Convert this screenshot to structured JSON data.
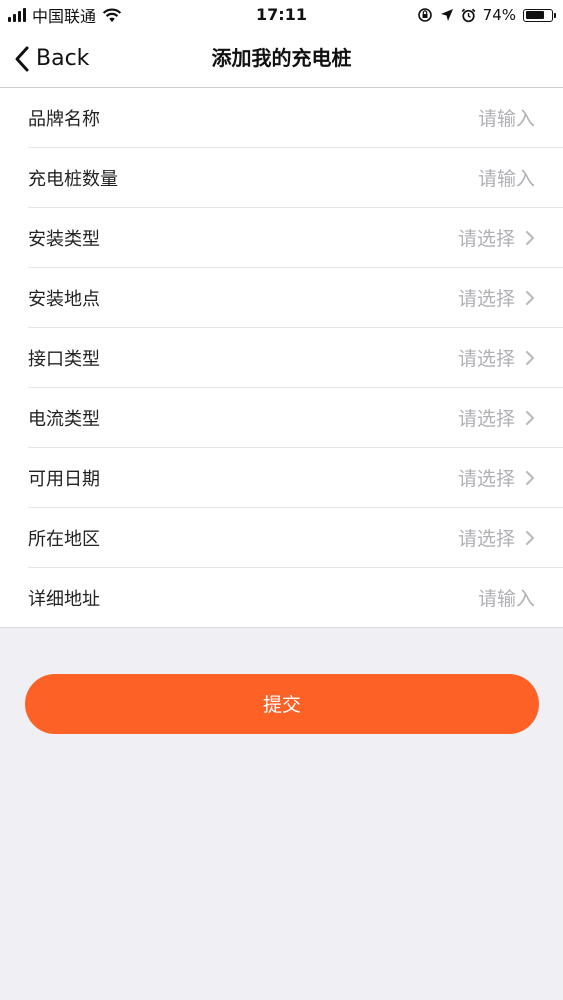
{
  "status_bar": {
    "carrier": "中国联通",
    "time": "17:11",
    "battery_percent": "74%",
    "battery_level": 0.74
  },
  "nav": {
    "back_label": "Back",
    "title": "添加我的充电桩"
  },
  "form": {
    "rows": [
      {
        "label": "品牌名称",
        "placeholder": "请输入",
        "type": "input"
      },
      {
        "label": "充电桩数量",
        "placeholder": "请输入",
        "type": "input"
      },
      {
        "label": "安装类型",
        "placeholder": "请选择",
        "type": "select"
      },
      {
        "label": "安装地点",
        "placeholder": "请选择",
        "type": "select"
      },
      {
        "label": "接口类型",
        "placeholder": "请选择",
        "type": "select"
      },
      {
        "label": "电流类型",
        "placeholder": "请选择",
        "type": "select"
      },
      {
        "label": "可用日期",
        "placeholder": "请选择",
        "type": "select"
      },
      {
        "label": "所在地区",
        "placeholder": "请选择",
        "type": "select"
      },
      {
        "label": "详细地址",
        "placeholder": "请输入",
        "type": "input"
      }
    ]
  },
  "submit": {
    "label": "提交",
    "color": "#fd6125"
  },
  "icons": {
    "back": "chevron-left-icon",
    "row_arrow": "chevron-right-icon",
    "wifi": "wifi-icon",
    "location": "location-arrow-icon",
    "alarm": "alarm-clock-icon",
    "orientation_lock": "orientation-lock-icon"
  }
}
